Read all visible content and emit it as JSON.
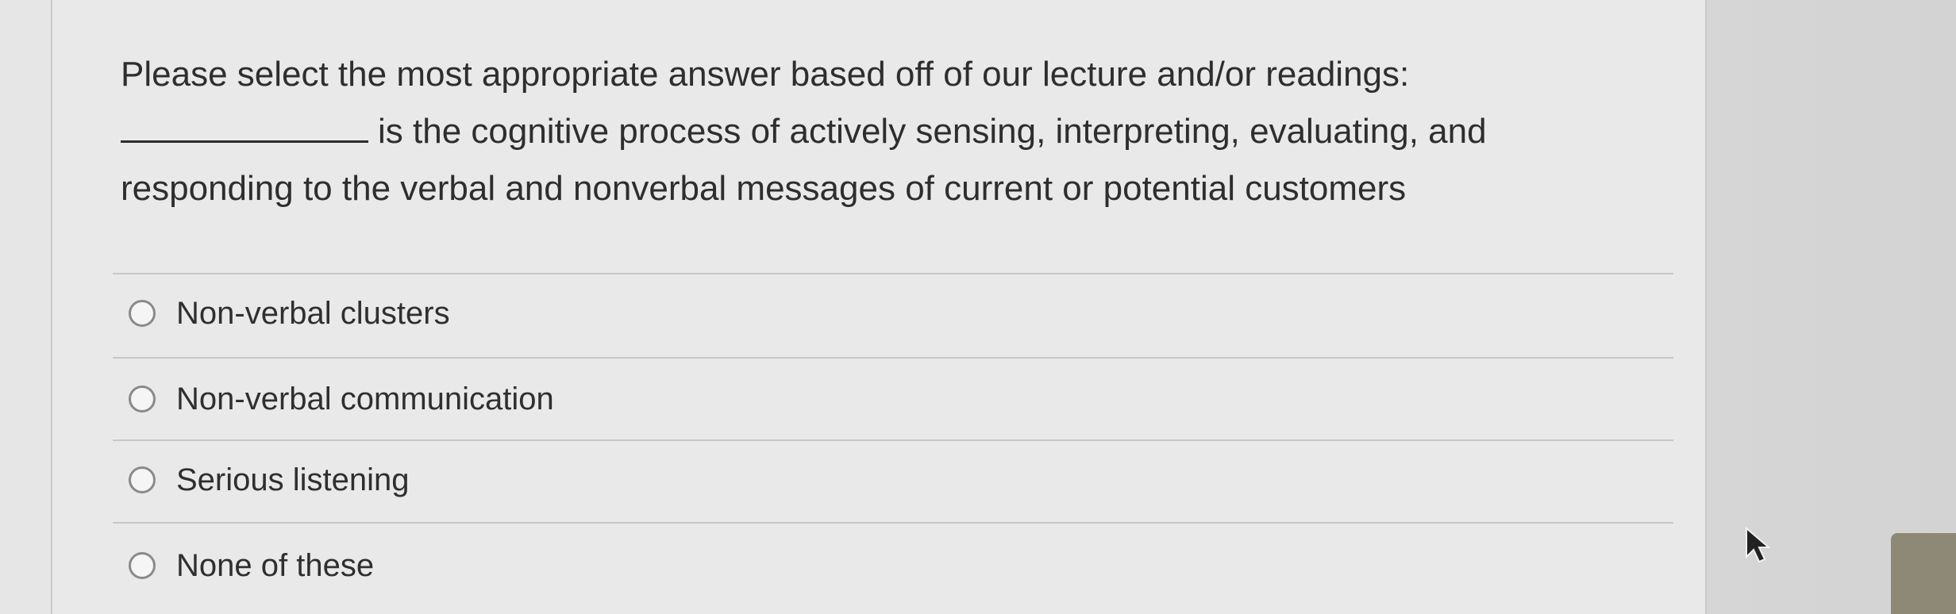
{
  "question": {
    "line1": "Please select the most appropriate answer based off of our lecture and/or readings:",
    "line2_after_blank": "is the cognitive process of actively sensing, interpreting, evaluating, and",
    "line3": "responding to the verbal and nonverbal messages of current or potential customers"
  },
  "options": [
    {
      "label": "Non-verbal clusters"
    },
    {
      "label": "Non-verbal communication"
    },
    {
      "label": "Serious listening"
    },
    {
      "label": "None of these"
    }
  ],
  "icons": {
    "cursor": "mouse-pointer-icon",
    "radio": "radio-button-icon"
  },
  "colors": {
    "background": "#e9e9e9",
    "text": "#2e2e2e",
    "radio_border": "#8a8a8a",
    "divider": "#c7c7c7"
  }
}
